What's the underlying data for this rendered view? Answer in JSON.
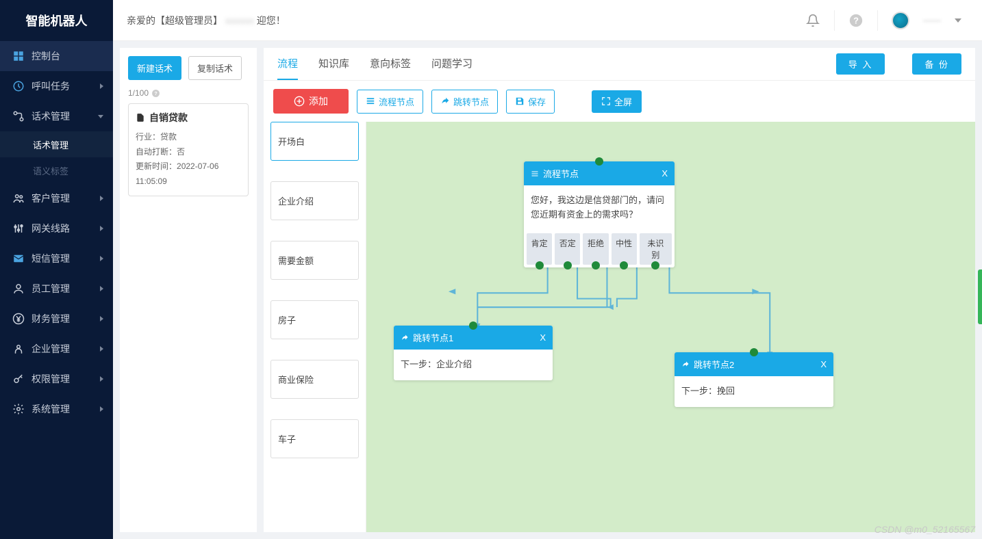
{
  "app_title": "智能机器人",
  "greeting_prefix": "亲爱的【超级管理员】",
  "greeting_suffix": "迎您！",
  "user_name": "——",
  "sidebar": [
    {
      "icon": "dashboard",
      "label": "控制台",
      "expand": false,
      "active": true
    },
    {
      "icon": "clock",
      "label": "呼叫任务",
      "expand": true
    },
    {
      "icon": "flow",
      "label": "话术管理",
      "expand": true,
      "open": true,
      "subs": [
        {
          "label": "话术管理",
          "sel": true
        },
        {
          "label": "语义标签",
          "sel": false
        }
      ]
    },
    {
      "icon": "users",
      "label": "客户管理",
      "expand": true
    },
    {
      "icon": "sliders",
      "label": "网关线路",
      "expand": true
    },
    {
      "icon": "mail",
      "label": "短信管理",
      "expand": true
    },
    {
      "icon": "person",
      "label": "员工管理",
      "expand": true
    },
    {
      "icon": "yen",
      "label": "财务管理",
      "expand": true
    },
    {
      "icon": "building",
      "label": "企业管理",
      "expand": true
    },
    {
      "icon": "key",
      "label": "权限管理",
      "expand": true
    },
    {
      "icon": "gear",
      "label": "系统管理",
      "expand": true
    }
  ],
  "left_panel": {
    "new_btn": "新建话术",
    "copy_btn": "复制话术",
    "count": "1/100",
    "card": {
      "title": "自销贷款",
      "industry_label": "行业：",
      "industry": "贷款",
      "auto_hangup_label": "自动打断：",
      "auto_hangup": "否",
      "update_label": "更新时间：",
      "update": "2022-07-06 11:05:09"
    }
  },
  "tabs": [
    "流程",
    "知识库",
    "意向标签",
    "问题学习"
  ],
  "active_tab": 0,
  "import_btn": "导 入",
  "backup_btn": "备 份",
  "toolbar": {
    "add": "添加",
    "flow_node": "流程节点",
    "jump_node": "跳转节点",
    "save": "保存",
    "fullscreen": "全屏"
  },
  "node_list": [
    "开场白",
    "企业介绍",
    "需要金额",
    "房子",
    "商业保险",
    "车子"
  ],
  "selected_node_idx": 0,
  "canvas": {
    "main_node": {
      "title": "流程节点",
      "body": "您好，我这边是信贷部门的，请问您近期有资金上的需求吗？",
      "options": [
        "肯定",
        "否定",
        "拒绝",
        "中性",
        "未识别"
      ]
    },
    "jump1": {
      "title": "跳转节点1",
      "body_label": "下一步：",
      "body_val": "企业介绍"
    },
    "jump2": {
      "title": "跳转节点2",
      "body_label": "下一步：",
      "body_val": "挽回"
    }
  },
  "watermark": "CSDN @m0_52165567"
}
